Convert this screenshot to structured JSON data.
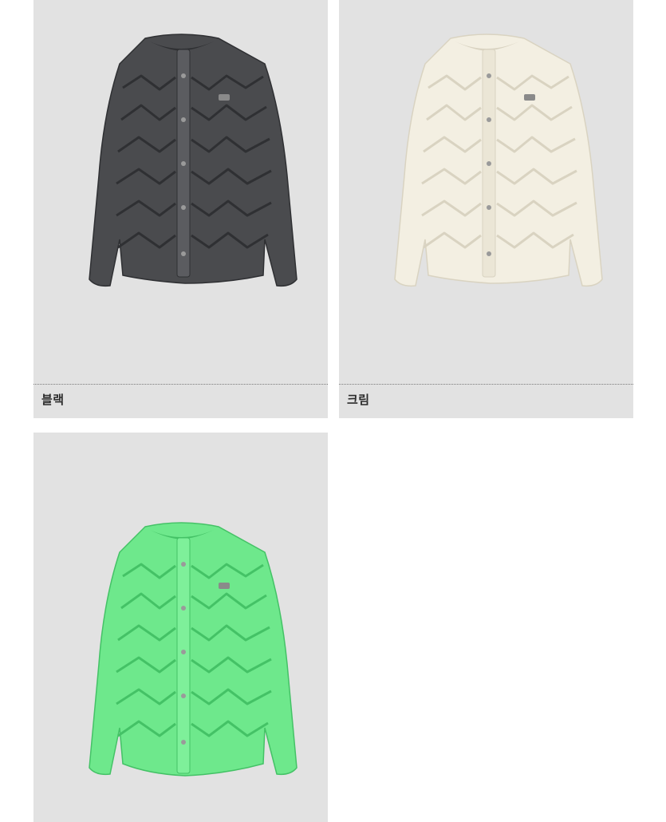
{
  "products": [
    {
      "color_label": "블랙",
      "jacket_color": "#4a4b4e",
      "shade_color": "#2f3033",
      "trim_color": "#5b5c60"
    },
    {
      "color_label": "크림",
      "jacket_color": "#f3efe2",
      "shade_color": "#d9d3c1",
      "trim_color": "#ebe6d6"
    },
    {
      "color_label": "",
      "jacket_color": "#6ee88c",
      "shade_color": "#44c266",
      "trim_color": "#7ef09a"
    }
  ],
  "colors": {
    "card_background": "#e2e2e2",
    "page_background": "#ffffff",
    "caption_text": "#2b2b2b"
  }
}
